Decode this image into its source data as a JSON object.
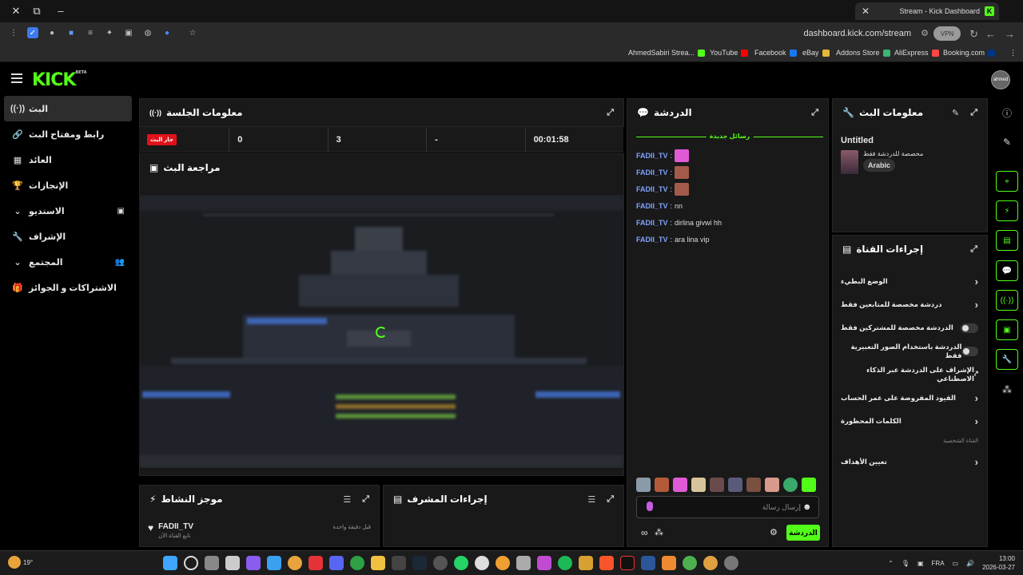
{
  "browser": {
    "tab_title": "Stream - Kick Dashboard",
    "url": "dashboard.kick.com/stream",
    "vpn_label": "VPN",
    "bookmarks": [
      {
        "label": "AhmedSabiri Strea...",
        "color": "#53fc18"
      },
      {
        "label": "YouTube",
        "color": "#ff0000"
      },
      {
        "label": "Facebook",
        "color": "#1877f2"
      },
      {
        "label": "eBay",
        "color": "#e53238"
      },
      {
        "label": "Addons Store",
        "color": "#3cb371"
      },
      {
        "label": "AliExpress",
        "color": "#ff4747"
      },
      {
        "label": "Booking.com",
        "color": "#003580"
      }
    ]
  },
  "brand": {
    "logo": "KICK",
    "logo_tag": "BETA",
    "accent": "#53fc18",
    "avatar_text": "ahmed"
  },
  "sidebar": {
    "items": [
      {
        "label": "البث",
        "icon": "broadcast-icon",
        "active": true
      },
      {
        "label": "رابط ومفتاح البث",
        "icon": "link-icon"
      },
      {
        "label": "العائد",
        "icon": "chart-icon"
      },
      {
        "label": "الإنجازات",
        "icon": "trophy-icon"
      },
      {
        "label": "الاستديو",
        "icon": "studio-icon",
        "has_chevron": true
      },
      {
        "label": "الإشراف",
        "icon": "wrench-icon"
      },
      {
        "label": "المجتمع",
        "icon": "users-icon",
        "has_chevron": true
      },
      {
        "label": "الاشتراكات و الجوائز",
        "icon": "gift-icon"
      }
    ]
  },
  "session": {
    "title": "معلومات الجلسة",
    "live_badge": "جار البث",
    "stats": [
      "0",
      "3",
      "-",
      "00:01:58"
    ]
  },
  "preview": {
    "title": "مراجعة البث"
  },
  "activity": {
    "title": "موجز النشاط",
    "item_user": "FADII_TV",
    "item_text": "تابع القناة الآن",
    "item_time": "قبل دقيقة واحدة"
  },
  "mod_actions": {
    "title": "إجراءات المشرف"
  },
  "chat": {
    "title": "الدردشة",
    "new_messages": "رسائل جديدة",
    "messages": [
      {
        "user": "FADII_TV",
        "text": "",
        "emote": "#e05ad8"
      },
      {
        "user": "FADII_TV",
        "text": "",
        "emote": "#b06050"
      },
      {
        "user": "FADII_TV",
        "text": "",
        "emote": "#b06050"
      },
      {
        "user": "FADII_TV",
        "text": "nn"
      },
      {
        "user": "FADII_TV",
        "text": "dirlina givwi hh"
      },
      {
        "user": "FADII_TV",
        "text": "ara lina vip"
      }
    ],
    "input_placeholder": "إرسال رسالة",
    "send_label": "الدردشة"
  },
  "stream_info": {
    "title": "معلومات البث",
    "stream_title": "Untitled",
    "category": "مخصصة للدردشة فقط",
    "language": "Arabic"
  },
  "channel_actions": {
    "title": "إجراءات القناة",
    "rows": [
      {
        "label": "الوضع البطيء",
        "control": "chevron"
      },
      {
        "label": "دردشة مخصصة للمتابعين فقط",
        "control": "chevron"
      },
      {
        "label": "الدردشة مخصصة للمشتركين فقط",
        "control": "toggle"
      },
      {
        "label": "الدردشة باستخدام الصور التعبيرية فقط",
        "control": "toggle"
      },
      {
        "label": "الإشراف على الدردشة عبر الذكاء الاصطناعي",
        "control": "external"
      },
      {
        "label": "القيود المفروضة على عمر الحساب",
        "control": "chevron"
      },
      {
        "label": "الكلمات المحظورة",
        "control": "chevron"
      }
    ],
    "section_label": "القناة الشخصية",
    "goals_label": "تعيين الأهداف"
  },
  "taskbar": {
    "weather": "19°",
    "lang": "FRA",
    "time": "13:00",
    "date": "2026-03-27"
  }
}
